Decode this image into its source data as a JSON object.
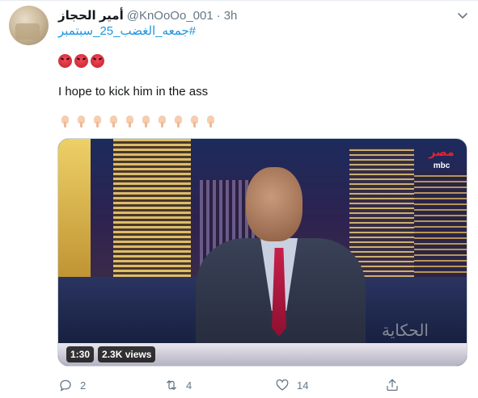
{
  "tweet": {
    "display_name": "أمير الحجاز",
    "handle": "@KnOoOo_001",
    "separator": "·",
    "time": "3h",
    "hashtag": "#جمعه_الغضب_25_سبتمبر",
    "emoji_reaction": {
      "icon": "angry-face-icon",
      "count": 3
    },
    "text": "I hope to kick him in the ass",
    "emoji_row": {
      "icon": "pointing-down-icon",
      "count": 10
    }
  },
  "media": {
    "type": "video",
    "logo_arabic": "مصر",
    "logo_brand": "mbc",
    "watermark": "الحكاية",
    "duration": "1:30",
    "views": "2.3K views"
  },
  "actions": {
    "reply_count": "2",
    "retweet_count": "4",
    "like_count": "14",
    "icons": [
      "reply-icon",
      "retweet-icon",
      "like-icon",
      "share-icon"
    ]
  },
  "colors": {
    "link": "#1b95e0",
    "secondary_text": "#657786",
    "primary_text": "#14171a"
  }
}
